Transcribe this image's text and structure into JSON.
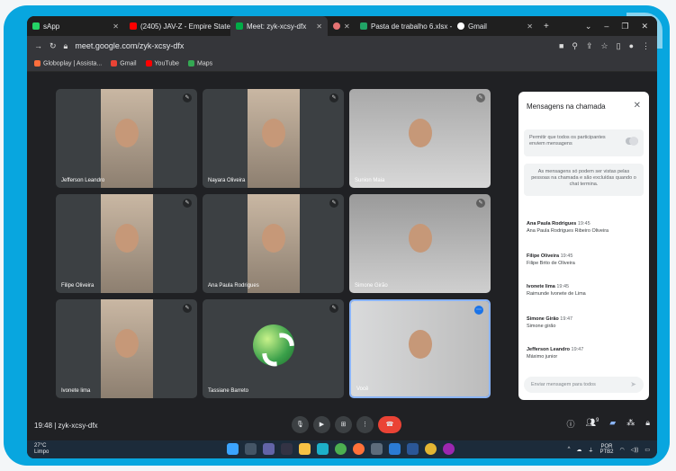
{
  "browser": {
    "tabs": [
      {
        "label": "sApp",
        "icon": "whatsapp-icon",
        "color": "#25d366"
      },
      {
        "label": "(2405) JAV-Z - Empire State I",
        "icon": "youtube-icon",
        "color": "#ff0000"
      },
      {
        "label": "Meet: zyk-xcsy-dfx",
        "icon": "meet-icon",
        "color": "#00ac47",
        "active": true
      },
      {
        "label": "",
        "icon": "audio-icon",
        "color": "#e57373"
      },
      {
        "label": "Pasta de trabalho 6.xlsx - Mi",
        "icon": "excel-icon",
        "color": "#21a366"
      },
      {
        "label": "Gmail",
        "icon": "google-icon",
        "color": "#ffffff"
      }
    ],
    "url": "meet.google.com/zyk-xcsy-dfx",
    "bookmarks": [
      {
        "label": "Globoplay | Assista...",
        "color": "#ff6f3c"
      },
      {
        "label": "Gmail",
        "color": "#ea4335"
      },
      {
        "label": "YouTube",
        "color": "#ff0000"
      },
      {
        "label": "Maps",
        "color": "#34a853"
      }
    ]
  },
  "participants": [
    {
      "name": "Jefferson Leandro"
    },
    {
      "name": "Nayara Oliveira"
    },
    {
      "name": "Sunion Maia"
    },
    {
      "name": "Filipe Oliveira"
    },
    {
      "name": "Ana Paula Rodrigues"
    },
    {
      "name": "Simone Girão"
    },
    {
      "name": "Ivonete lima"
    },
    {
      "name": "Tassiane Barreto"
    },
    {
      "name": "Você"
    }
  ],
  "chat": {
    "title": "Mensagens na chamada",
    "permission": "Permitir que todos os participantes enviem mensagens",
    "note": "As mensagens só podem ser vistas pelas pessoas na chamada e são excluídas quando o chat termina.",
    "messages": [
      {
        "sender": "Ana Paula Rodrigues",
        "time": "19:45",
        "text": "Ana Paula Rodrigues Ribeiro Oliveira"
      },
      {
        "sender": "Filipe Oliveira",
        "time": "19:45",
        "text": "Filipe Brito de Oliveira"
      },
      {
        "sender": "Ivonete lima",
        "time": "19:45",
        "text": "Raimunde Ivonete de Lima"
      },
      {
        "sender": "Simone Girão",
        "time": "19:47",
        "text": "Simone girão"
      },
      {
        "sender": "Jefferson Leandro",
        "time": "19:47",
        "text": "Máximo junior"
      }
    ],
    "input_placeholder": "Enviar mensagem para todos"
  },
  "meeting": {
    "time_code": "19:48 | zyk-xcsy-dfx",
    "participants_badge": "9"
  },
  "taskbar": {
    "temp": "27°C",
    "condition": "Limpo",
    "lang": "POR",
    "layout": "PTB2"
  }
}
